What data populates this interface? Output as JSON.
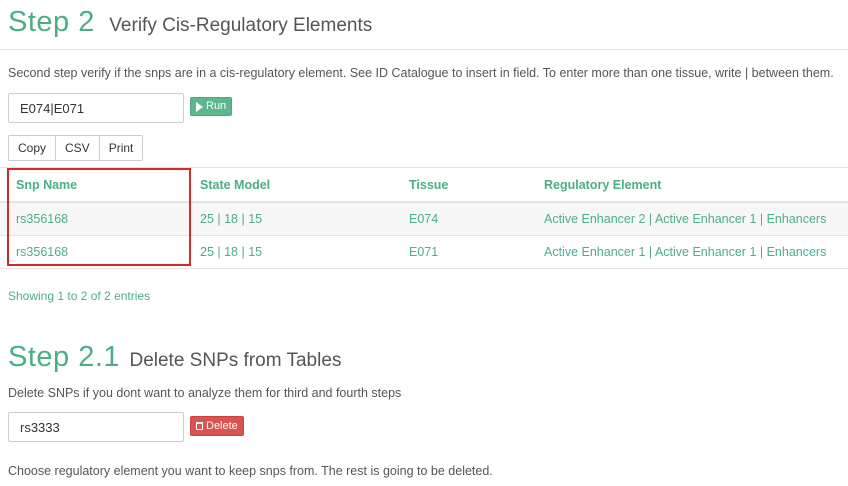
{
  "step2": {
    "title": "Step 2",
    "subtitle": "Verify Cis-Regulatory Elements",
    "description": "Second step verify if the snps are in a cis-regulatory element. See ID Catalogue to insert in field. To enter more than one tissue, write | between them.",
    "input_value": "E074|E071",
    "run_label": "Run"
  },
  "export_buttons": [
    "Copy",
    "CSV",
    "Print"
  ],
  "table": {
    "columns": [
      "Snp Name",
      "State Model",
      "Tissue",
      "Regulatory Element"
    ],
    "rows": [
      [
        "rs356168",
        "25 | 18 | 15",
        "E074",
        "Active Enhancer 2 | Active Enhancer 1 | Enhancers"
      ],
      [
        "rs356168",
        "25 | 18 | 15",
        "E071",
        "Active Enhancer 1 | Active Enhancer 1 | Enhancers"
      ]
    ],
    "info": "Showing 1 to 2 of 2 entries"
  },
  "step21": {
    "title": "Step 2.1",
    "subtitle": "Delete SNPs from Tables",
    "description": "Delete SNPs if you dont want to analyze them for third and fourth steps",
    "input_value": "rs3333",
    "delete_label": "Delete",
    "footer_text": "Choose regulatory element you want to keep snps from. The rest is going to be deleted."
  },
  "colors": {
    "accent": "#4cae84",
    "danger": "#d9534f",
    "highlight": "#d42a2a"
  }
}
